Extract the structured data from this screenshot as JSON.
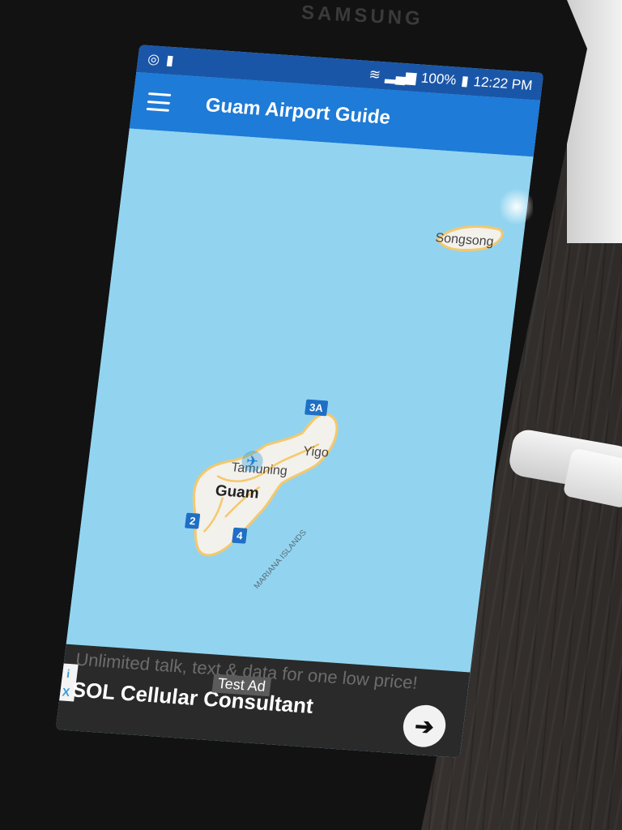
{
  "device": {
    "brand": "SAMSUNG"
  },
  "status_bar": {
    "battery": "100%",
    "time": "12:22 PM",
    "icons": [
      "sync-icon",
      "battery-saver-icon",
      "wifi-icon",
      "signal-icon",
      "battery-icon"
    ]
  },
  "app_bar": {
    "title": "Guam Airport Guide",
    "menu_icon": "hamburger-menu-icon"
  },
  "map": {
    "labels": {
      "songsong": "Songsong",
      "yigo": "Yigo",
      "tamuning": "Tamuning",
      "guam": "Guam",
      "mariana": "MARIANA ISLANDS"
    },
    "route_badges": [
      "3A",
      "2",
      "4"
    ],
    "airport_icon": "airplane-icon",
    "colors": {
      "water": "#92d4f0",
      "land": "#f3f1ec",
      "roads": "#f5c86b"
    }
  },
  "ad": {
    "background_text": "Unlimited talk, text & data for one low price!",
    "title": "SOL Cellular Consultant",
    "test_badge": "Test Ad",
    "choices": "i",
    "close": "X",
    "arrow_icon": "arrow-right-icon"
  },
  "colors": {
    "status_bar": "#1a56a8",
    "app_bar": "#1e7bd7",
    "ad_background": "#2a2a2a"
  }
}
